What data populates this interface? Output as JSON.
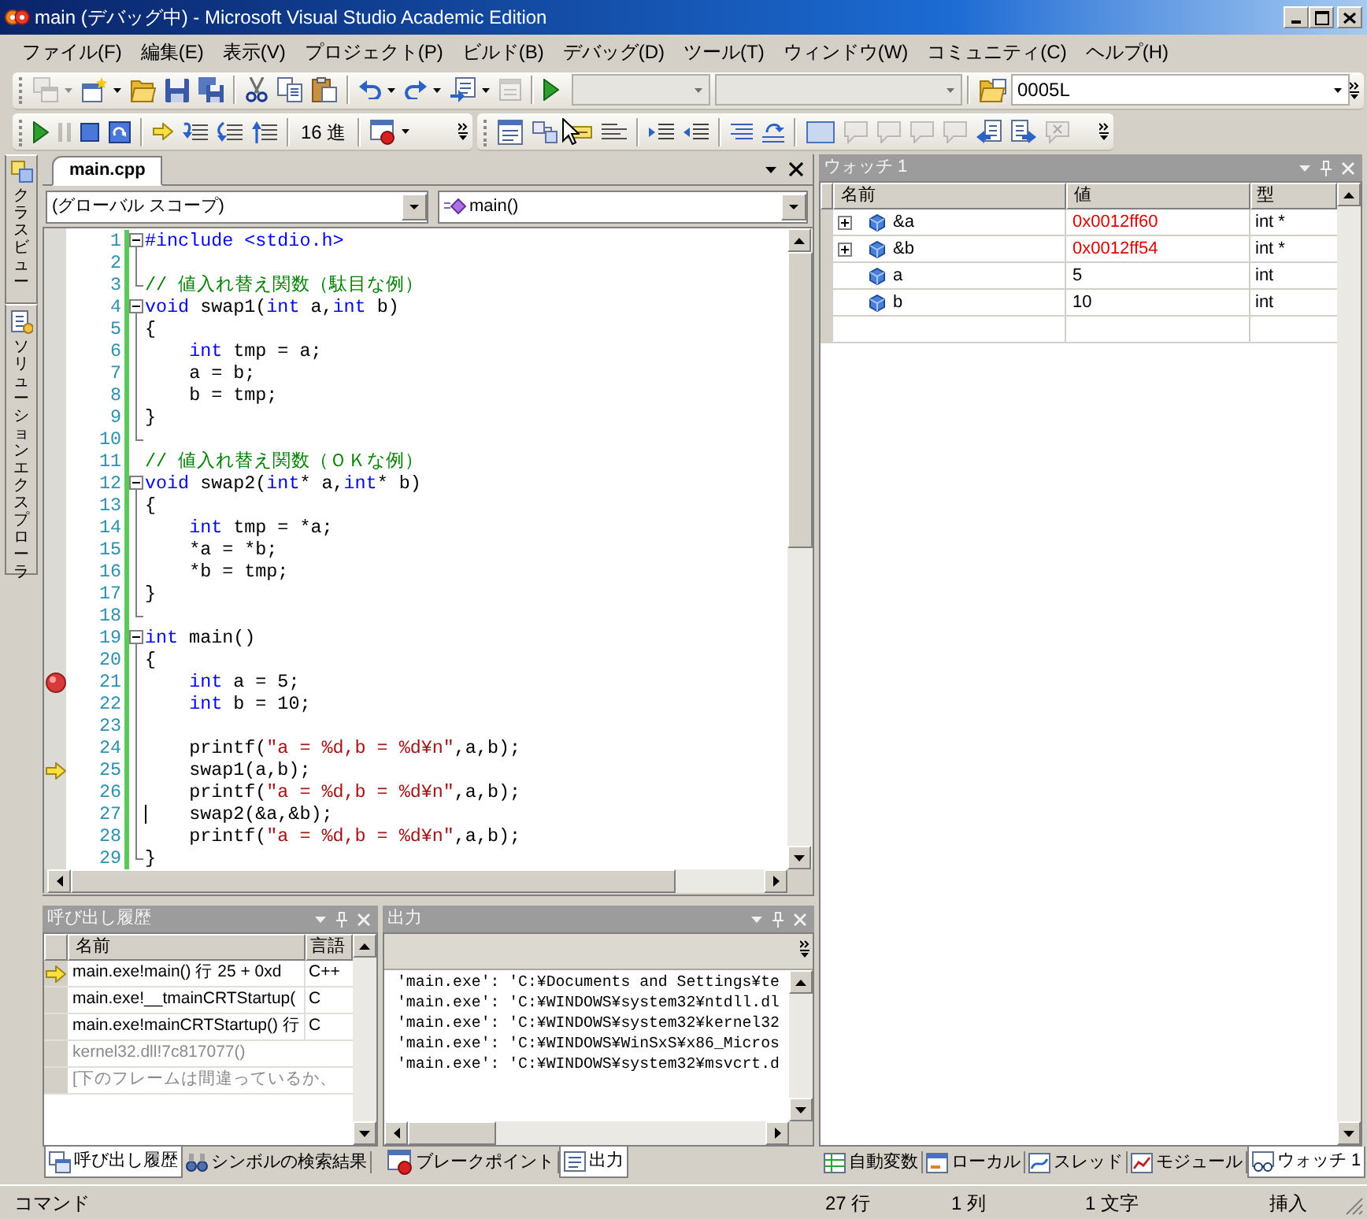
{
  "window": {
    "title": "main (デバッグ中) - Microsoft Visual Studio Academic Edition"
  },
  "menu": [
    "ファイル(F)",
    "編集(E)",
    "表示(V)",
    "プロジェクト(P)",
    "ビルド(B)",
    "デバッグ(D)",
    "ツール(T)",
    "ウィンドウ(W)",
    "コミュニティ(C)",
    "ヘルプ(H)"
  ],
  "standard_toolbar": {
    "buttons": [
      {
        "disabled": true
      },
      {
        "disabled": false
      },
      {
        "disabled": false
      },
      {
        "disabled": false
      },
      {
        "disabled": false
      },
      {
        "disabled": false
      },
      {
        "disabled": false
      },
      {
        "disabled": false
      },
      {
        "disabled": false
      },
      {
        "disabled": false
      },
      {
        "disabled": false
      },
      {
        "disabled": true
      },
      {
        "disabled": false
      },
      {
        "disabled": false
      }
    ],
    "find_combo": {
      "value": "0005L"
    }
  },
  "debug_toolbar": {
    "buttons": [
      {
        "disabled": false
      },
      {
        "disabled": true
      },
      {
        "disabled": false
      },
      {
        "disabled": false
      },
      {
        "disabled": false
      },
      {
        "disabled": false
      },
      {
        "disabled": false
      },
      {
        "disabled": false
      },
      {
        "disabled": false
      }
    ],
    "hex_button": "16 進"
  },
  "edit_toolbar": {
    "buttons": [
      {
        "disabled": false
      },
      {
        "disabled": false
      },
      {
        "disabled": false
      },
      {
        "disabled": false
      },
      {
        "disabled": false
      },
      {
        "disabled": false
      },
      {
        "disabled": false
      },
      {
        "disabled": false
      },
      {
        "disabled": false
      },
      {
        "disabled": true
      },
      {
        "disabled": true
      },
      {
        "disabled": true
      },
      {
        "disabled": true
      },
      {
        "disabled": false
      },
      {
        "disabled": false
      },
      {
        "disabled": true
      }
    ]
  },
  "side_tabs": [
    {
      "label": "クラスビュー"
    },
    {
      "label": "ソリューションエクスプローラ"
    }
  ],
  "editor": {
    "tabs": [
      {
        "label": "main.cpp",
        "selected": true
      }
    ],
    "scope": "(グローバル スコープ)",
    "member": "main()",
    "lines": [
      {
        "number": "1",
        "kind": "open",
        "breakpoint": false,
        "current": false,
        "tokens": [
          {
            "kind": "keyword",
            "text": "#include <stdio.h>"
          }
        ]
      },
      {
        "number": "2",
        "kind": "inside",
        "breakpoint": false,
        "current": false
      },
      {
        "number": "3",
        "kind": "close",
        "breakpoint": false,
        "current": false,
        "tokens": [
          {
            "kind": "comment",
            "text": "// 値入れ替え関数（駄目な例）"
          }
        ]
      },
      {
        "number": "4",
        "kind": "open",
        "breakpoint": false,
        "current": false,
        "tokens": [
          {
            "kind": "keyword",
            "text": "void"
          },
          {
            "kind": "plain",
            "text": " swap1("
          },
          {
            "kind": "keyword",
            "text": "int"
          },
          {
            "kind": "plain",
            "text": " a,"
          },
          {
            "kind": "keyword",
            "text": "int"
          },
          {
            "kind": "plain",
            "text": " b)"
          }
        ]
      },
      {
        "number": "5",
        "kind": "inside",
        "breakpoint": false,
        "current": false,
        "tokens": [
          {
            "kind": "plain",
            "text": "{"
          }
        ]
      },
      {
        "number": "6",
        "kind": "inside",
        "breakpoint": false,
        "current": false,
        "tokens": [
          {
            "kind": "keyword",
            "text": "    int"
          },
          {
            "kind": "plain",
            "text": " tmp = a;"
          }
        ]
      },
      {
        "number": "7",
        "kind": "inside",
        "breakpoint": false,
        "current": false,
        "tokens": [
          {
            "kind": "plain",
            "text": "    a = b;"
          }
        ]
      },
      {
        "number": "8",
        "kind": "inside",
        "breakpoint": false,
        "current": false,
        "tokens": [
          {
            "kind": "plain",
            "text": "    b = tmp;"
          }
        ]
      },
      {
        "number": "9",
        "kind": "inside",
        "breakpoint": false,
        "current": false,
        "tokens": [
          {
            "kind": "plain",
            "text": "}"
          }
        ]
      },
      {
        "number": "10",
        "kind": "close",
        "breakpoint": false,
        "current": false
      },
      {
        "number": "11",
        "kind": "plain",
        "breakpoint": false,
        "current": false,
        "tokens": [
          {
            "kind": "comment",
            "text": "// 値入れ替え関数（ＯＫな例）"
          }
        ]
      },
      {
        "number": "12",
        "kind": "open",
        "breakpoint": false,
        "current": false,
        "tokens": [
          {
            "kind": "keyword",
            "text": "void"
          },
          {
            "kind": "plain",
            "text": " swap2("
          },
          {
            "kind": "keyword",
            "text": "int"
          },
          {
            "kind": "plain",
            "text": "* a,"
          },
          {
            "kind": "keyword",
            "text": "int"
          },
          {
            "kind": "plain",
            "text": "* b)"
          }
        ]
      },
      {
        "number": "13",
        "kind": "inside",
        "breakpoint": false,
        "current": false,
        "tokens": [
          {
            "kind": "plain",
            "text": "{"
          }
        ]
      },
      {
        "number": "14",
        "kind": "inside",
        "breakpoint": false,
        "current": false,
        "tokens": [
          {
            "kind": "keyword",
            "text": "    int"
          },
          {
            "kind": "plain",
            "text": " tmp = *a;"
          }
        ]
      },
      {
        "number": "15",
        "kind": "inside",
        "breakpoint": false,
        "current": false,
        "tokens": [
          {
            "kind": "plain",
            "text": "    *a = *b;"
          }
        ]
      },
      {
        "number": "16",
        "kind": "inside",
        "breakpoint": false,
        "current": false,
        "tokens": [
          {
            "kind": "plain",
            "text": "    *b = tmp;"
          }
        ]
      },
      {
        "number": "17",
        "kind": "inside",
        "breakpoint": false,
        "current": false,
        "tokens": [
          {
            "kind": "plain",
            "text": "}"
          }
        ]
      },
      {
        "number": "18",
        "kind": "close",
        "breakpoint": false,
        "current": false
      },
      {
        "number": "19",
        "kind": "open",
        "breakpoint": false,
        "current": false,
        "tokens": [
          {
            "kind": "keyword",
            "text": "int"
          },
          {
            "kind": "plain",
            "text": " main()"
          }
        ]
      },
      {
        "number": "20",
        "kind": "inside",
        "breakpoint": false,
        "current": false,
        "tokens": [
          {
            "kind": "plain",
            "text": "{"
          }
        ]
      },
      {
        "number": "21",
        "kind": "inside",
        "breakpoint": true,
        "current": false,
        "tokens": [
          {
            "kind": "keyword",
            "text": "    int"
          },
          {
            "kind": "plain",
            "text": " a = 5;"
          }
        ]
      },
      {
        "number": "22",
        "kind": "inside",
        "breakpoint": false,
        "current": false,
        "tokens": [
          {
            "kind": "keyword",
            "text": "    int"
          },
          {
            "kind": "plain",
            "text": " b = 10;"
          }
        ]
      },
      {
        "number": "23",
        "kind": "inside",
        "breakpoint": false,
        "current": false
      },
      {
        "number": "24",
        "kind": "inside",
        "breakpoint": false,
        "current": false,
        "tokens": [
          {
            "kind": "plain",
            "text": "    printf("
          },
          {
            "kind": "string",
            "text": "\"a = %d,b = %d¥n\""
          },
          {
            "kind": "plain",
            "text": ",a,b);"
          }
        ]
      },
      {
        "number": "25",
        "kind": "inside",
        "breakpoint": false,
        "current": true,
        "tokens": [
          {
            "kind": "plain",
            "text": "    swap1(a,b);"
          }
        ]
      },
      {
        "number": "26",
        "kind": "inside",
        "breakpoint": false,
        "current": false,
        "tokens": [
          {
            "kind": "plain",
            "text": "    printf("
          },
          {
            "kind": "string",
            "text": "\"a = %d,b = %d¥n\""
          },
          {
            "kind": "plain",
            "text": ",a,b);"
          }
        ]
      },
      {
        "number": "27",
        "kind": "inside",
        "breakpoint": false,
        "current": false,
        "cursor": true,
        "tokens": [
          {
            "kind": "plain",
            "text": "    swap2(&a,&b);"
          }
        ]
      },
      {
        "number": "28",
        "kind": "inside",
        "breakpoint": false,
        "current": false,
        "tokens": [
          {
            "kind": "plain",
            "text": "    printf("
          },
          {
            "kind": "string",
            "text": "\"a = %d,b = %d¥n\""
          },
          {
            "kind": "plain",
            "text": ",a,b);"
          }
        ]
      },
      {
        "number": "29",
        "kind": "close",
        "breakpoint": false,
        "current": false,
        "tokens": [
          {
            "kind": "plain",
            "text": "}"
          }
        ]
      }
    ]
  },
  "watch": {
    "title": "ウォッチ 1",
    "columns": [
      "名前",
      "値",
      "型"
    ],
    "rows": [
      {
        "name": "&a",
        "value": "0x0012ff60",
        "type": "int *",
        "expandable": true,
        "changed": true
      },
      {
        "name": "&b",
        "value": "0x0012ff54",
        "type": "int *",
        "expandable": true,
        "changed": true
      },
      {
        "name": "a",
        "value": "5",
        "type": "int",
        "expandable": false,
        "changed": false
      },
      {
        "name": "b",
        "value": "10",
        "type": "int",
        "expandable": false,
        "changed": false
      }
    ]
  },
  "call_stack": {
    "title": "呼び出し履歴",
    "columns": [
      "名前",
      "言語"
    ],
    "rows": [
      {
        "name": "main.exe!main() 行 25 + 0xd",
        "language": "C++",
        "current": true,
        "greyed": false
      },
      {
        "name": "main.exe!__tmainCRTStartup(",
        "language": "C",
        "current": false,
        "greyed": false
      },
      {
        "name": "main.exe!mainCRTStartup() 行",
        "language": "C",
        "current": false,
        "greyed": false
      },
      {
        "name": "kernel32.dll!7c817077()",
        "current": false,
        "greyed": true
      },
      {
        "name": "[下のフレームは間違っているか、",
        "current": false,
        "greyed": true
      }
    ]
  },
  "output": {
    "title": "出力",
    "lines": [
      "'main.exe': 'C:¥Documents and Settings¥te",
      "'main.exe': 'C:¥WINDOWS¥system32¥ntdll.dl",
      "'main.exe': 'C:¥WINDOWS¥system32¥kernel32",
      "'main.exe': 'C:¥WINDOWS¥WinSxS¥x86_Micros",
      "'main.exe': 'C:¥WINDOWS¥system32¥msvcrt.d"
    ]
  },
  "bottom_tabs_left": [
    {
      "label": "呼び出し履歴",
      "selected": true
    },
    {
      "label": "シンボルの検索結果",
      "selected": false
    }
  ],
  "bottom_tabs_middle": [
    {
      "label": "ブレークポイント",
      "selected": false
    },
    {
      "label": "出力",
      "selected": true
    }
  ],
  "bottom_tabs_right": [
    {
      "label": "自動変数",
      "selected": false
    },
    {
      "label": "ローカル",
      "selected": false
    },
    {
      "label": "スレッド",
      "selected": false
    },
    {
      "label": "モジュール",
      "selected": false
    },
    {
      "label": "ウォッチ 1",
      "selected": true
    }
  ],
  "status_bar": {
    "message": "コマンド",
    "line": "27 行",
    "column": "1 列",
    "character": "1 文字",
    "mode": "挿入"
  }
}
